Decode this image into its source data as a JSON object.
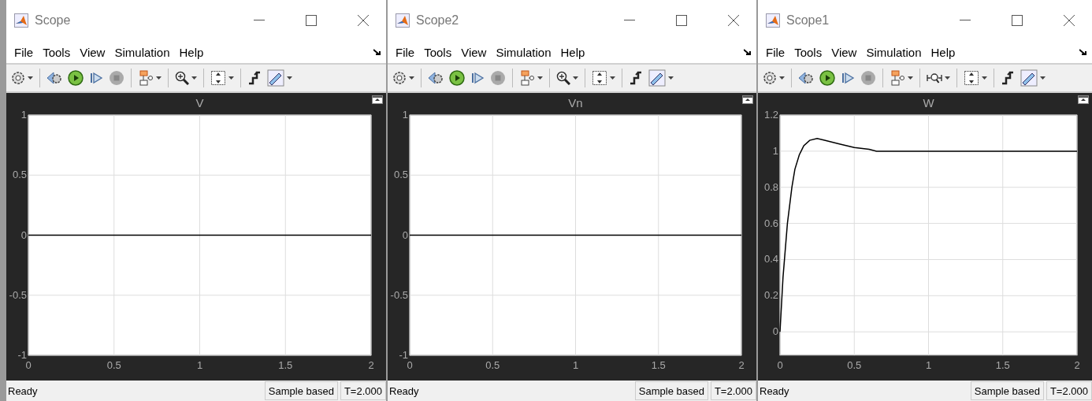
{
  "windows": [
    {
      "title": "Scope",
      "menu": [
        "File",
        "Tools",
        "View",
        "Simulation",
        "Help"
      ],
      "zoom_x_only": false,
      "stop_disabled": true,
      "plot": {
        "chart_data": {
          "type": "line",
          "title": "V",
          "x": [
            0,
            2
          ],
          "series": [
            {
              "color": "#000000",
              "values": [
                0,
                0
              ]
            }
          ],
          "xlim": [
            0,
            2
          ],
          "ylim": [
            -1,
            1
          ],
          "xticks": [
            0,
            0.5,
            1,
            1.5,
            2
          ],
          "yticks": [
            -1,
            -0.5,
            0,
            0.5,
            1
          ],
          "grid": true
        }
      },
      "status": "Ready",
      "sample_mode": "Sample based",
      "time": "T=2.000"
    },
    {
      "title": "Scope2",
      "menu": [
        "File",
        "Tools",
        "View",
        "Simulation",
        "Help"
      ],
      "zoom_x_only": false,
      "stop_disabled": true,
      "plot": {
        "chart_data": {
          "type": "line",
          "title": "Vn",
          "x": [
            0,
            2
          ],
          "series": [
            {
              "color": "#000000",
              "values": [
                0,
                0
              ]
            }
          ],
          "xlim": [
            0,
            2
          ],
          "ylim": [
            -1,
            1
          ],
          "xticks": [
            0,
            0.5,
            1,
            1.5,
            2
          ],
          "yticks": [
            -1,
            -0.5,
            0,
            0.5,
            1
          ],
          "grid": true
        }
      },
      "status": "Ready",
      "sample_mode": "Sample based",
      "time": "T=2.000"
    },
    {
      "title": "Scope1",
      "menu": [
        "File",
        "Tools",
        "View",
        "Simulation",
        "Help"
      ],
      "zoom_x_only": true,
      "stop_disabled": true,
      "plot": {
        "chart_data": {
          "type": "line",
          "title": "W",
          "x": [
            0,
            0.02,
            0.05,
            0.08,
            0.1,
            0.13,
            0.16,
            0.2,
            0.25,
            0.3,
            0.4,
            0.5,
            0.6,
            0.65,
            1,
            1.5,
            2
          ],
          "series": [
            {
              "color": "#000000",
              "values": [
                0,
                0.3,
                0.6,
                0.8,
                0.9,
                0.98,
                1.03,
                1.06,
                1.07,
                1.06,
                1.04,
                1.02,
                1.01,
                1.0,
                1.0,
                1.0,
                1.0
              ]
            }
          ],
          "xlim": [
            0,
            2
          ],
          "ylim": [
            -0.13,
            1.2
          ],
          "xticks": [
            0,
            0.5,
            1,
            1.5,
            2
          ],
          "yticks": [
            0,
            0.2,
            0.4,
            0.6,
            0.8,
            1,
            1.2
          ],
          "grid": true
        }
      },
      "status": "Ready",
      "sample_mode": "Sample based",
      "time": "T=2.000"
    }
  ]
}
